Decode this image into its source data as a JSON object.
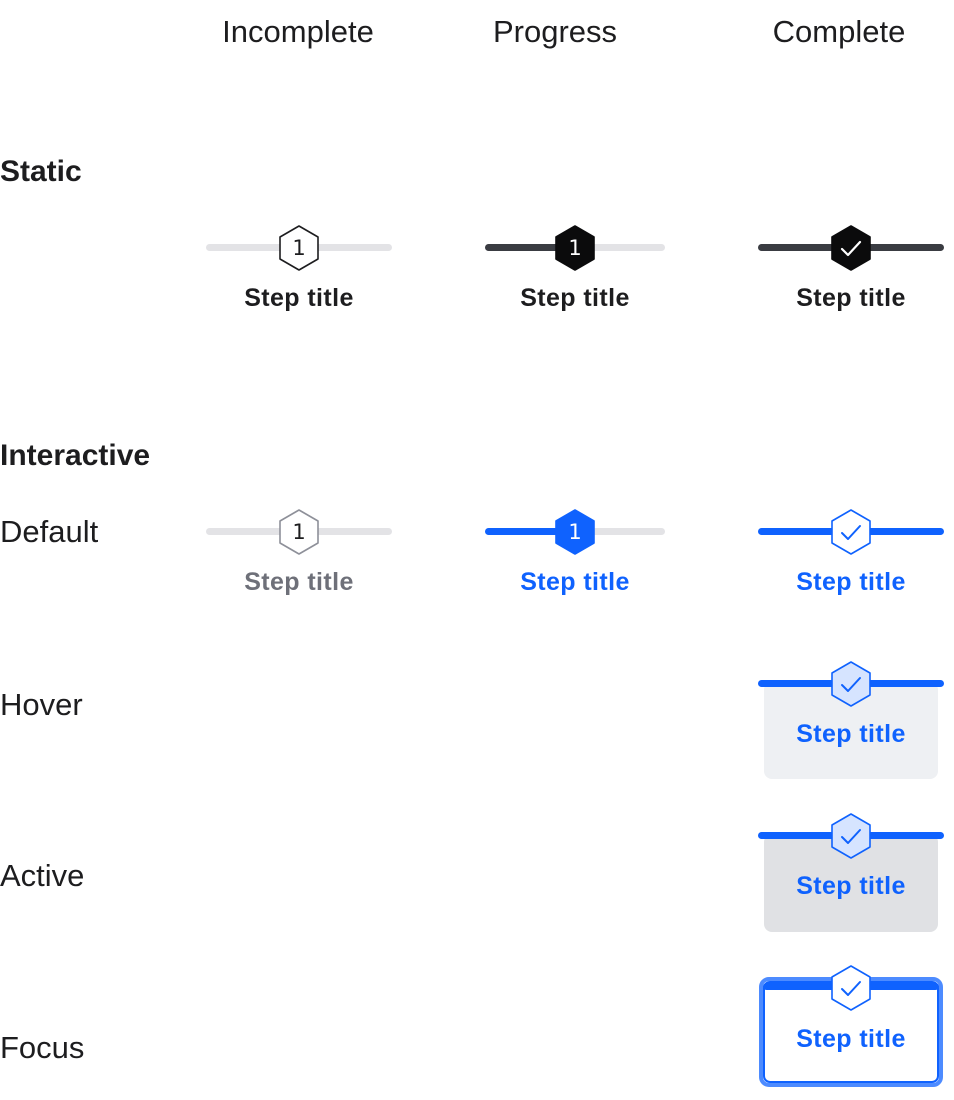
{
  "columns": {
    "incomplete": "Incomplete",
    "progress": "Progress",
    "complete": "Complete"
  },
  "sections": {
    "static": "Static",
    "interactive": "Interactive"
  },
  "rows": {
    "default": "Default",
    "hover": "Hover",
    "active": "Active",
    "focus": "Focus"
  },
  "step": {
    "title": "Step title",
    "number": "1"
  },
  "colors": {
    "blue": "#0f62fe",
    "dark": "#1d1d1f",
    "track_gray": "#e3e3e6",
    "muted_text": "#6e7079",
    "hover_bg": "#eef0f3",
    "active_bg": "#e0e1e4",
    "focus_border": "#4d8bff",
    "check_fill_light": "#d6e4ff"
  }
}
